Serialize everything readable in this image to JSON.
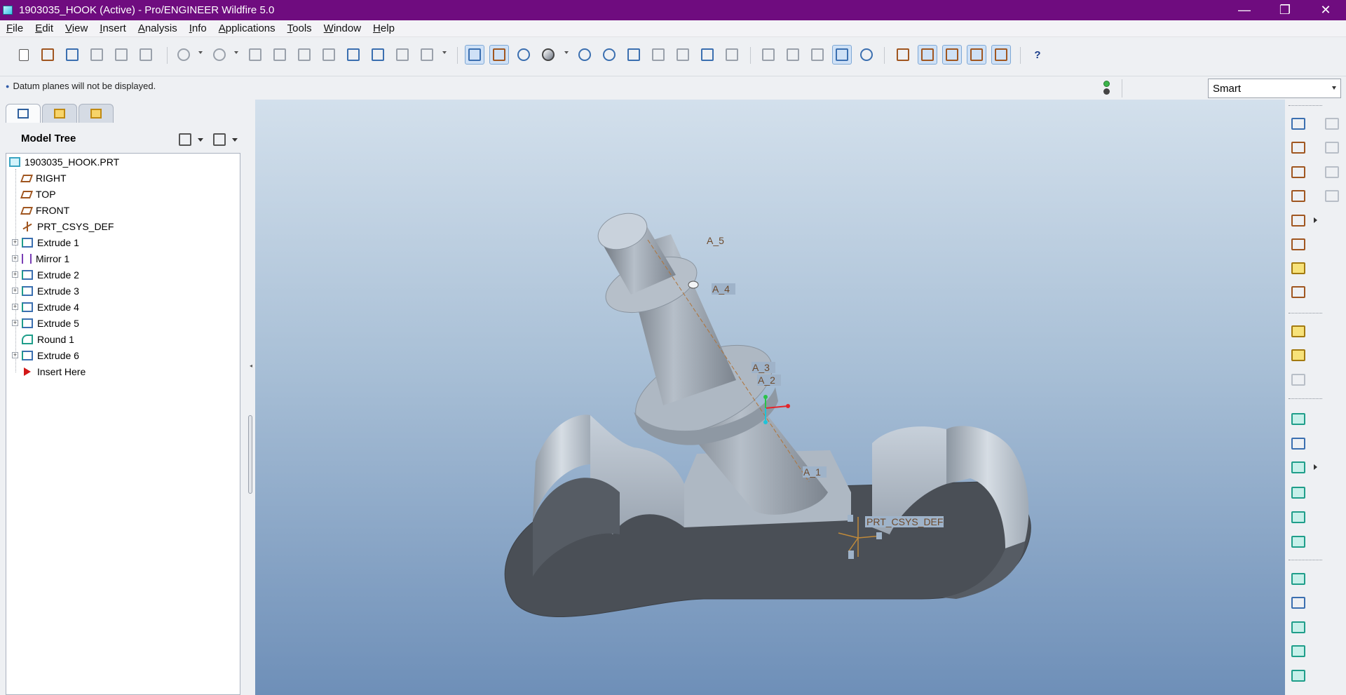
{
  "window": {
    "title": "1903035_HOOK (Active) - Pro/ENGINEER Wildfire 5.0",
    "controls": [
      "—",
      "❐",
      "✕"
    ]
  },
  "menubar": {
    "items": [
      "File",
      "Edit",
      "View",
      "Insert",
      "Analysis",
      "Info",
      "Applications",
      "Tools",
      "Window",
      "Help"
    ]
  },
  "toolbar": {
    "help_label": "?"
  },
  "message_bar": {
    "message": "Datum planes will not be displayed.",
    "filter_value": "Smart"
  },
  "model_tree": {
    "title": "Model Tree",
    "items": [
      {
        "label": "1903035_HOOK.PRT",
        "icon": "part-icon",
        "expandable": false
      },
      {
        "label": "RIGHT",
        "icon": "datum-plane-icon",
        "expandable": false
      },
      {
        "label": "TOP",
        "icon": "datum-plane-icon",
        "expandable": false
      },
      {
        "label": "FRONT",
        "icon": "datum-plane-icon",
        "expandable": false
      },
      {
        "label": "PRT_CSYS_DEF",
        "icon": "csys-icon",
        "expandable": false
      },
      {
        "label": "Extrude 1",
        "icon": "extrude-icon",
        "expandable": true
      },
      {
        "label": "Mirror 1",
        "icon": "mirror-icon",
        "expandable": true
      },
      {
        "label": "Extrude 2",
        "icon": "extrude-icon",
        "expandable": true
      },
      {
        "label": "Extrude 3",
        "icon": "extrude-icon",
        "expandable": true
      },
      {
        "label": "Extrude 4",
        "icon": "extrude-icon",
        "expandable": true
      },
      {
        "label": "Extrude 5",
        "icon": "extrude-icon",
        "expandable": true
      },
      {
        "label": "Round 1",
        "icon": "round-icon",
        "expandable": false
      },
      {
        "label": "Extrude 6",
        "icon": "extrude-icon",
        "expandable": true
      },
      {
        "label": "Insert Here",
        "icon": "insert-arrow-icon",
        "expandable": false
      }
    ]
  },
  "viewport": {
    "axis_labels": [
      "A_5",
      "A_4",
      "A_3",
      "A_2",
      "A_1"
    ],
    "csys_label": "PRT_CSYS_DEF"
  },
  "colors": {
    "titlebar": "#6f0c7f",
    "model_shade": "#4a4f56",
    "model_light": "#b9c2cc",
    "datum_brown": "#a05620"
  }
}
